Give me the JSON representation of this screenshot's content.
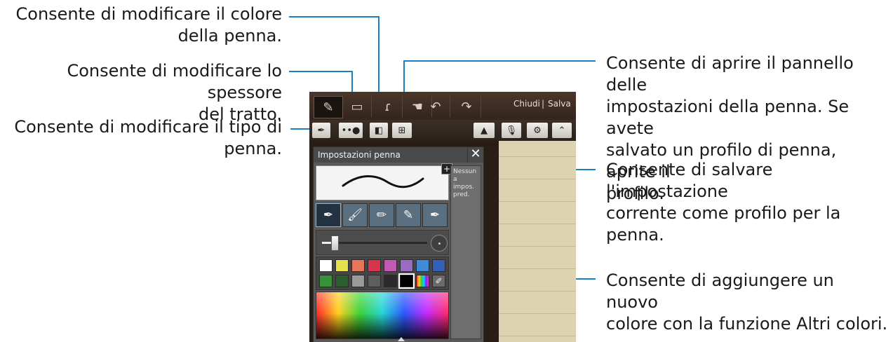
{
  "callouts": {
    "color_l1": "Consente di modificare il colore",
    "color_l2": "della penna.",
    "thickness_l1": "Consente di modificare lo spessore",
    "thickness_l2": "del tratto.",
    "type_l1": "Consente di modificare il tipo di",
    "type_l2": "penna.",
    "settings_l1": "Consente di aprire il pannello delle",
    "settings_l2": "impostazioni della penna. Se avete",
    "settings_l3": "salvato un profilo di penna, aprite il",
    "settings_l4": "profilo.",
    "save_l1": "Consente di salvare l'impostazione",
    "save_l2": "corrente come profilo per la penna.",
    "addcolor_l1": "Consente di aggiungere un nuovo",
    "addcolor_l2": "colore con la funzione Altri colori."
  },
  "toolbar": {
    "close_label": "Chiudi",
    "save_label": "Salva",
    "icons": [
      "pen-icon",
      "eraser-icon",
      "lasso-icon",
      "hand-icon",
      "undo-icon",
      "redo-icon"
    ]
  },
  "pen_panel": {
    "title": "Impostazioni penna",
    "close_glyph": "✕",
    "add_profile_glyph": "+",
    "profiles_empty_text": "Nessun a impos. pred.",
    "pen_types": [
      "fountain-pen",
      "brush",
      "pencil",
      "marker",
      "calligraphy"
    ],
    "thickness_level": 0.12,
    "palette_colors": [
      "#ffffff",
      "#e6e04a",
      "#e6775a",
      "#d9344a",
      "#c25ab4",
      "#9a6ac4",
      "#3f8bd6",
      "#3460b8",
      "#3a8f3a",
      "#2a5e30",
      "#9b9b9b",
      "#5e5e5e",
      "#2b2b2b",
      "#000000"
    ],
    "selected_color": "#000000"
  }
}
